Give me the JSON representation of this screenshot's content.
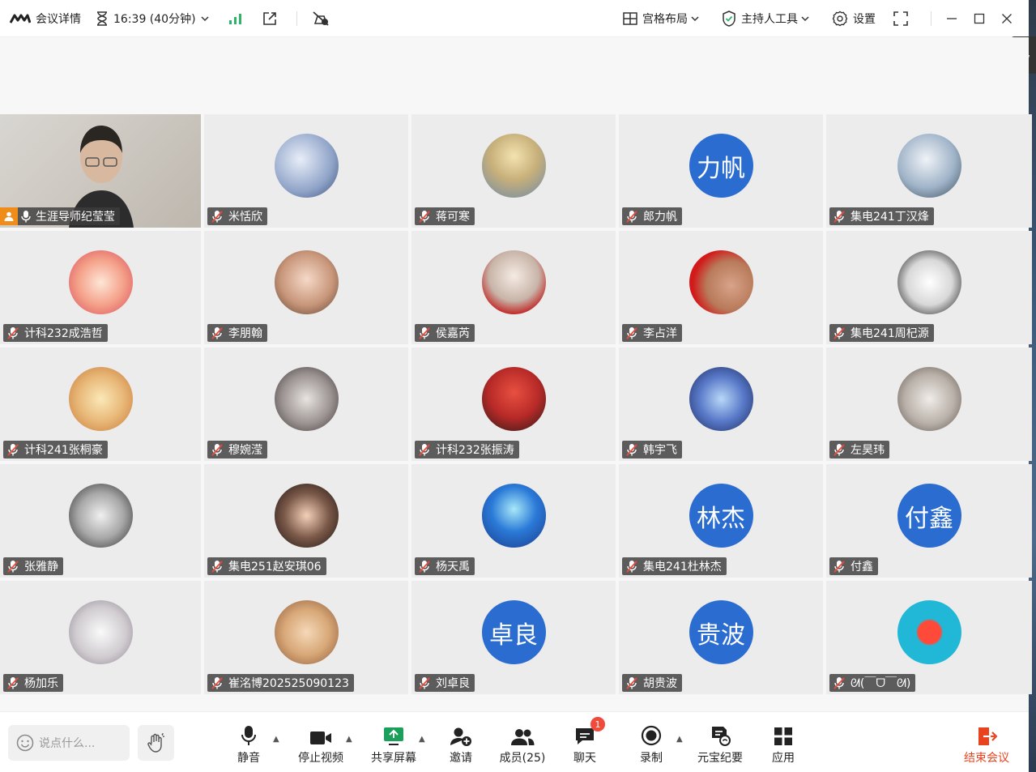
{
  "titlebar": {
    "meeting_details": "会议详情",
    "timer": "16:39 (40分钟)",
    "layout": "宫格布局",
    "host_tools": "主持人工具",
    "settings": "设置"
  },
  "colors": {
    "accent": "#2a6ccf",
    "danger": "#e8431e",
    "host": "#f08c1a",
    "signal": "#2fb36a",
    "share": "#1aa05a"
  },
  "participants": [
    {
      "name": "生涯导师纪莹莹",
      "type": "video",
      "host": true
    },
    {
      "name": "米恬欣",
      "type": "photo"
    },
    {
      "name": "蒋可寒",
      "type": "photo"
    },
    {
      "name": "郎力帆",
      "type": "initials",
      "initials": "力帆"
    },
    {
      "name": "集电241丁汉烽",
      "type": "photo"
    },
    {
      "name": "计科232成浩哲",
      "type": "photo"
    },
    {
      "name": "李朋翰",
      "type": "photo"
    },
    {
      "name": "侯嘉芮",
      "type": "photo"
    },
    {
      "name": "李占洋",
      "type": "photo"
    },
    {
      "name": "集电241周杞源",
      "type": "photo"
    },
    {
      "name": "计科241张桐豪",
      "type": "photo"
    },
    {
      "name": "穆婉滢",
      "type": "photo"
    },
    {
      "name": "计科232张振涛",
      "type": "photo"
    },
    {
      "name": "韩宇飞",
      "type": "photo"
    },
    {
      "name": "左昊玮",
      "type": "photo"
    },
    {
      "name": "张雅静",
      "type": "photo"
    },
    {
      "name": "集电251赵安琪06",
      "type": "photo"
    },
    {
      "name": "杨天禹",
      "type": "photo"
    },
    {
      "name": "集电241杜林杰",
      "type": "initials",
      "initials": "林杰"
    },
    {
      "name": "付鑫",
      "type": "initials",
      "initials": "付鑫"
    },
    {
      "name": "杨加乐",
      "type": "photo"
    },
    {
      "name": "崔洺博202525090123",
      "type": "photo"
    },
    {
      "name": "刘卓良",
      "type": "initials",
      "initials": "卓良"
    },
    {
      "name": "胡贵波",
      "type": "initials",
      "initials": "贵波"
    },
    {
      "name": "ᘛ(￣ᗜ￣ᘛ)",
      "type": "photo"
    }
  ],
  "toolbar": {
    "chat_placeholder": "说点什么...",
    "mute": "静音",
    "stop_video": "停止视频",
    "share_screen": "共享屏幕",
    "invite": "邀请",
    "members": "成员(25)",
    "chat": "聊天",
    "chat_badge": "1",
    "record": "录制",
    "yuanbao": "元宝纪要",
    "apps": "应用",
    "end_meeting": "结束会议"
  }
}
